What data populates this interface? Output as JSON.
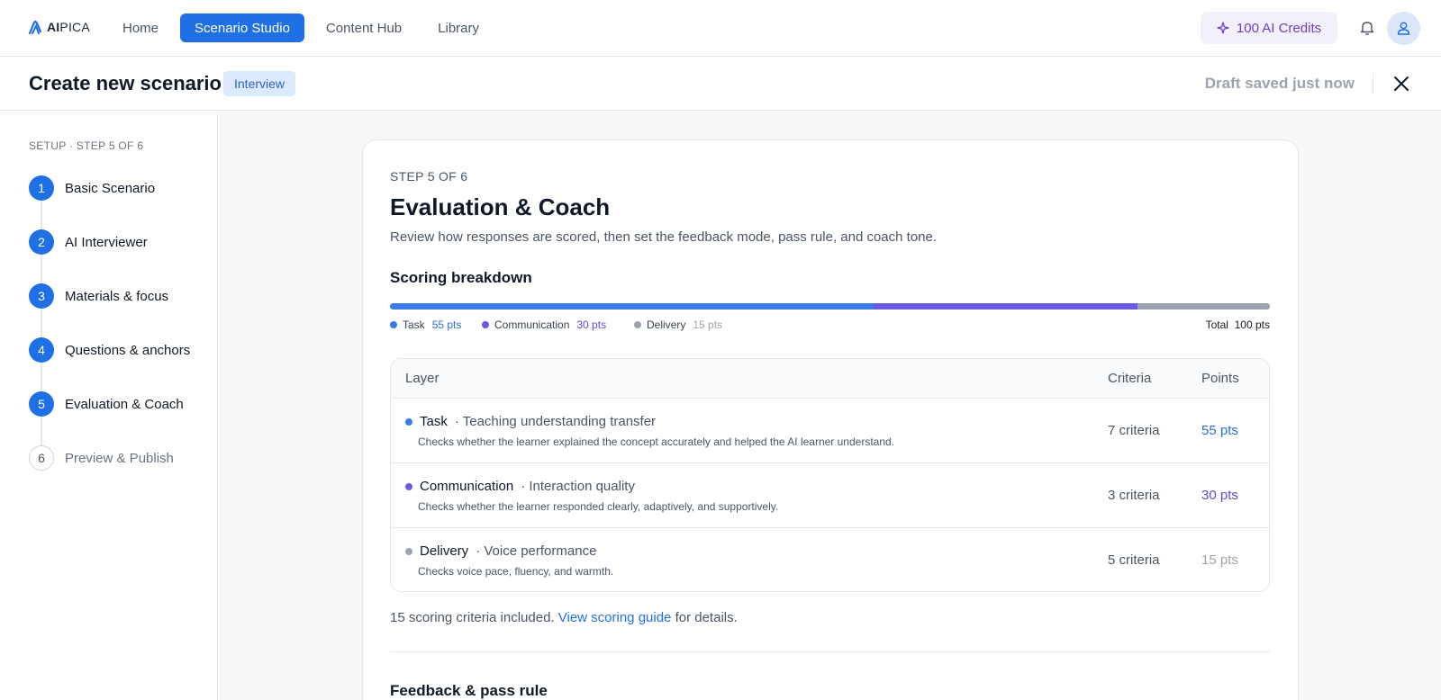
{
  "topnav": {
    "brand": {
      "bold": "AI",
      "light": "PICA"
    },
    "tabs": [
      {
        "label": "Home",
        "active": false
      },
      {
        "label": "Scenario Studio",
        "active": true
      },
      {
        "label": "Content Hub",
        "active": false
      },
      {
        "label": "Library",
        "active": false
      }
    ],
    "credits_label": "100 AI Credits",
    "icons": {
      "credits": "sparkle-icon",
      "notifications": "bell-icon",
      "account": "user-icon"
    }
  },
  "header": {
    "title": "Create new scenario",
    "type_badge": "Interview",
    "draft_status": "Draft saved just now",
    "close_icon": "close-icon"
  },
  "sidebar": {
    "progress_label": "SETUP · STEP 5 OF 6",
    "steps": [
      {
        "number": "1",
        "label": "Basic Scenario",
        "state": "done"
      },
      {
        "number": "2",
        "label": "AI Interviewer",
        "state": "done"
      },
      {
        "number": "3",
        "label": "Materials & focus",
        "state": "done"
      },
      {
        "number": "4",
        "label": "Questions & anchors",
        "state": "done"
      },
      {
        "number": "5",
        "label": "Evaluation & Coach",
        "state": "current"
      },
      {
        "number": "6",
        "label": "Preview & Publish",
        "state": "pending"
      }
    ]
  },
  "main": {
    "step_kicker": "STEP 5 OF 6",
    "title": "Evaluation & Coach",
    "description": "Review how responses are scored, then set the feedback mode, pass rule, and coach tone.",
    "scoring": {
      "section_title": "Scoring breakdown",
      "segments": [
        {
          "name": "Task",
          "points_label": "55 pts",
          "points": 55,
          "color": "#3b7be8"
        },
        {
          "name": "Communication",
          "points_label": "30 pts",
          "points": 30,
          "color": "#6a5ae0"
        },
        {
          "name": "Delivery",
          "points_label": "15 pts",
          "points": 15,
          "color": "#9ca3af"
        }
      ],
      "total_label": "Total",
      "total_value": "100 pts",
      "table": {
        "headers": {
          "layer": "Layer",
          "criteria": "Criteria",
          "points": "Points"
        },
        "rows": [
          {
            "name": "Task",
            "subtitle": "· Teaching understanding transfer",
            "description": "Checks whether the learner explained the concept accurately and helped the AI learner understand.",
            "criteria": "7 criteria",
            "points": "55 pts",
            "color": "#3b7be8",
            "points_color": "#2a6fd6"
          },
          {
            "name": "Communication",
            "subtitle": "· Interaction quality",
            "description": "Checks whether the learner responded clearly, adaptively, and supportively.",
            "criteria": "3 criteria",
            "points": "30 pts",
            "color": "#6a5ae0",
            "points_color": "#5a4bd1"
          },
          {
            "name": "Delivery",
            "subtitle": "· Voice performance",
            "description": "Checks voice pace, fluency, and warmth.",
            "criteria": "5 criteria",
            "points": "15 pts",
            "color": "#9ca3af",
            "points_color": "#9ca3af"
          }
        ]
      },
      "footnote": {
        "prefix": "15 scoring criteria included.",
        "link": "View scoring guide",
        "suffix": "for details."
      }
    },
    "feedback_section_title": "Feedback & pass rule"
  }
}
